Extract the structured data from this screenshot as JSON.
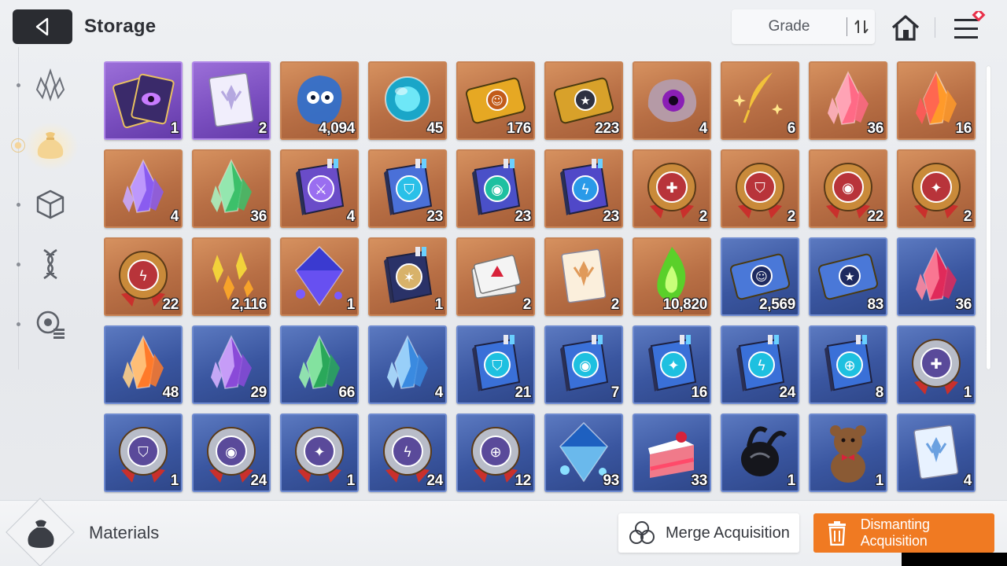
{
  "header": {
    "title": "Storage",
    "sort_label": "Grade",
    "back_icon": "back-arrow-icon",
    "sort_icon": "sort-arrows-icon",
    "home_icon": "home-icon",
    "menu_icon": "menu-icon"
  },
  "sidebar": {
    "items": [
      {
        "icon": "crystal-cluster-icon",
        "active": false
      },
      {
        "icon": "material-pouch-icon",
        "active": true
      },
      {
        "icon": "cube-icon",
        "active": false
      },
      {
        "icon": "dna-helix-icon",
        "active": false
      },
      {
        "icon": "module-list-icon",
        "active": false
      }
    ]
  },
  "items": [
    {
      "art": "purple-eye-cards",
      "grade": "purple",
      "count": "1"
    },
    {
      "art": "white-book",
      "grade": "purple",
      "count": "2"
    },
    {
      "art": "blue-spirit",
      "grade": "orange",
      "count": "4,094"
    },
    {
      "art": "cyan-orb",
      "grade": "orange",
      "count": "45"
    },
    {
      "art": "gold-ticket-portrait",
      "grade": "orange",
      "count": "176"
    },
    {
      "art": "gold-ticket-star",
      "grade": "orange",
      "count": "223"
    },
    {
      "art": "purple-eye-blob",
      "grade": "orange",
      "count": "4"
    },
    {
      "art": "gold-feather",
      "grade": "orange",
      "count": "6"
    },
    {
      "art": "pink-crystal",
      "grade": "orange",
      "count": "36"
    },
    {
      "art": "amber-crystal",
      "grade": "orange",
      "count": "16"
    },
    {
      "art": "purple-crystal",
      "grade": "orange",
      "count": "4"
    },
    {
      "art": "green-crystal",
      "grade": "orange",
      "count": "36"
    },
    {
      "art": "book-swords",
      "grade": "orange",
      "count": "4"
    },
    {
      "art": "book-shield",
      "grade": "orange",
      "count": "23"
    },
    {
      "art": "book-eye",
      "grade": "orange",
      "count": "23"
    },
    {
      "art": "book-bolt",
      "grade": "orange",
      "count": "23"
    },
    {
      "art": "gear-medal-sword",
      "grade": "orange",
      "count": "2"
    },
    {
      "art": "gear-medal-shield",
      "grade": "orange",
      "count": "2"
    },
    {
      "art": "gear-medal-eye",
      "grade": "orange",
      "count": "22"
    },
    {
      "art": "gear-medal-dagger",
      "grade": "orange",
      "count": "2"
    },
    {
      "art": "gear-medal-bolt",
      "grade": "orange",
      "count": "22"
    },
    {
      "art": "gold-shards",
      "grade": "orange",
      "count": "2,116"
    },
    {
      "art": "blue-octahedron",
      "grade": "orange",
      "count": "1"
    },
    {
      "art": "star-map-book",
      "grade": "orange",
      "count": "1"
    },
    {
      "art": "red-cards",
      "grade": "orange",
      "count": "2"
    },
    {
      "art": "cream-book",
      "grade": "orange",
      "count": "2"
    },
    {
      "art": "green-flame",
      "grade": "orange",
      "count": "10,820"
    },
    {
      "art": "blue-ticket-portrait",
      "grade": "blue",
      "count": "2,569"
    },
    {
      "art": "blue-ticket-star",
      "grade": "blue",
      "count": "83"
    },
    {
      "art": "red-crystal",
      "grade": "blue",
      "count": "36"
    },
    {
      "art": "orange-crystal",
      "grade": "blue",
      "count": "48"
    },
    {
      "art": "violet-crystal",
      "grade": "blue",
      "count": "29"
    },
    {
      "art": "emerald-crystal",
      "grade": "blue",
      "count": "66"
    },
    {
      "art": "ice-crystal",
      "grade": "blue",
      "count": "4"
    },
    {
      "art": "blue-book-shield",
      "grade": "blue",
      "count": "21"
    },
    {
      "art": "blue-book-eye",
      "grade": "blue",
      "count": "7"
    },
    {
      "art": "blue-book-dagger",
      "grade": "blue",
      "count": "16"
    },
    {
      "art": "blue-book-bolt",
      "grade": "blue",
      "count": "24"
    },
    {
      "art": "blue-book-target",
      "grade": "blue",
      "count": "8"
    },
    {
      "art": "silver-medal-sword",
      "grade": "blue",
      "count": "1"
    },
    {
      "art": "silver-medal-shield",
      "grade": "blue",
      "count": "1"
    },
    {
      "art": "silver-medal-eye",
      "grade": "blue",
      "count": "24"
    },
    {
      "art": "silver-medal-dagger",
      "grade": "blue",
      "count": "1"
    },
    {
      "art": "silver-medal-bolt",
      "grade": "blue",
      "count": "24"
    },
    {
      "art": "silver-medal-target",
      "grade": "blue",
      "count": "12"
    },
    {
      "art": "frost-gem",
      "grade": "blue",
      "count": "93"
    },
    {
      "art": "strawberry-cake",
      "grade": "blue",
      "count": "33"
    },
    {
      "art": "black-beetle",
      "grade": "blue",
      "count": "1"
    },
    {
      "art": "teddy-bear",
      "grade": "blue",
      "count": "1"
    },
    {
      "art": "blue-white-book",
      "grade": "blue",
      "count": "4"
    }
  ],
  "footer": {
    "category_label": "Materials",
    "category_icon": "material-pouch-icon",
    "merge_label": "Merge Acquisition",
    "merge_icon": "merge-circles-icon",
    "dismantle_label": "Dismanting Acquisition",
    "dismantle_icon": "trash-icon"
  },
  "colors": {
    "accent_orange": "#f07a22",
    "tile_orange": "#b86f45",
    "tile_blue": "#3a56a0",
    "tile_purple": "#7b4fc0"
  }
}
